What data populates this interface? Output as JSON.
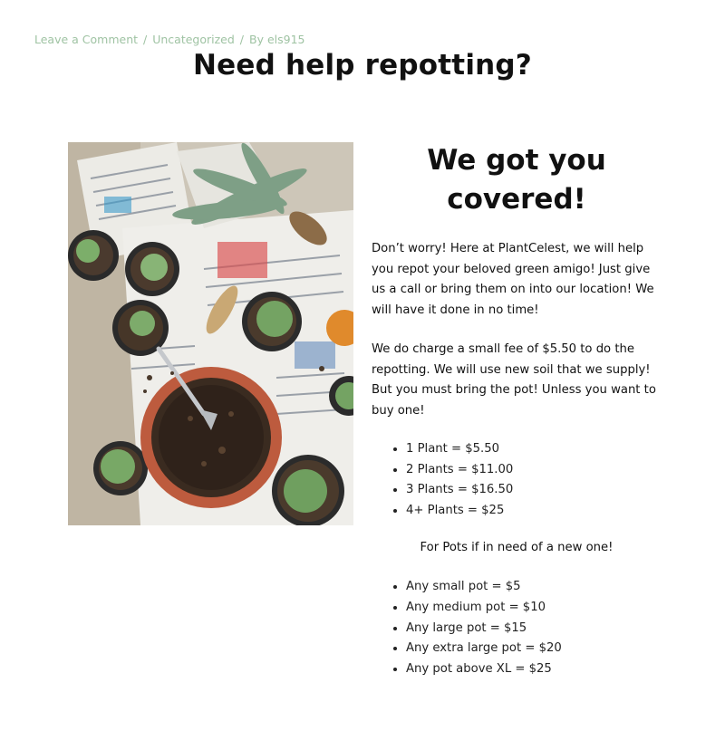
{
  "post_meta": {
    "comment_link": "Leave a Comment",
    "category": "Uncategorized",
    "author_prefix": "By",
    "author": "els915",
    "separator": "/",
    "color": "#9fc3a3"
  },
  "page": {
    "title": "Need help repotting?"
  },
  "image": {
    "icon": "plant-photo-icon"
  },
  "content": {
    "heading": "We got you covered!",
    "paragraph1": "Don’t worry! Here at PlantCelest, we will help you repot your beloved green amigo! Just give us a call or bring them on into our location! We will have it done in no time!",
    "paragraph2": "We do charge a small fee of $5.50 to do the repotting. We will use new soil that we supply! But you must bring the pot! Unless you want to buy one!",
    "plant_prices": [
      "1 Plant = $5.50",
      "2 Plants = $11.00",
      "3 Plants = $16.50",
      "4+ Plants = $25"
    ],
    "pots_note": "For Pots if in need of a new one!",
    "pot_prices": [
      "Any small pot = $5",
      "Any medium pot = $10",
      "Any large pot = $15",
      "Any extra large pot = $20",
      "Any pot above XL = $25"
    ]
  }
}
